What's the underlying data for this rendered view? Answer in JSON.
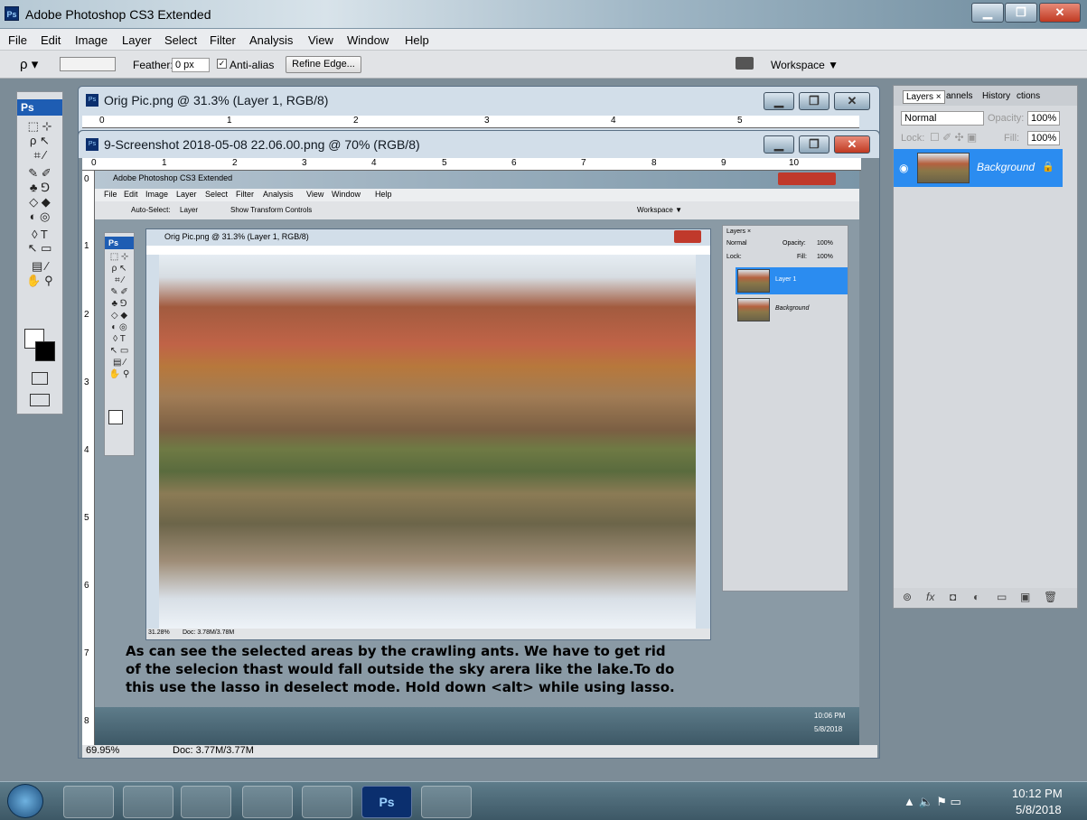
{
  "app": {
    "title": "Adobe Photoshop CS3 Extended",
    "logo": "Ps"
  },
  "menubar": {
    "items": [
      "File",
      "Edit",
      "Image",
      "Layer",
      "Select",
      "Filter",
      "Analysis",
      "View",
      "Window",
      "Help"
    ]
  },
  "options": {
    "feather_label": "Feather:",
    "feather_value": "0 px",
    "antialias_label": "Anti-alias",
    "refine_label": "Refine Edge...",
    "workspace_label": "Workspace ▼"
  },
  "windows": {
    "orig_title": "Orig Pic.png @ 31.3% (Layer 1, RGB/8)",
    "screenshot_title": "9-Screenshot 2018-05-08 22.06.00.png @ 70% (RGB/8)",
    "status_zoom": "69.95%",
    "status_doc": "Doc: 3.77M/3.77M"
  },
  "ruler": {
    "top_ticks": [
      "0",
      "1",
      "2",
      "3",
      "4",
      "5",
      "6",
      "7",
      "8",
      "9",
      "10"
    ],
    "left_ticks": [
      "0",
      "1",
      "2",
      "3",
      "4",
      "5",
      "6",
      "7",
      "8"
    ],
    "orig_ticks": [
      "0",
      "1",
      "2",
      "3",
      "4",
      "5"
    ]
  },
  "inner_ps": {
    "title": "Adobe Photoshop CS3 Extended",
    "menu": [
      "File",
      "Edit",
      "Image",
      "Layer",
      "Select",
      "Filter",
      "Analysis",
      "View",
      "Window",
      "Help"
    ],
    "auto_select": "Auto-Select:",
    "layer_sel": "Layer",
    "show_transform": "Show Transform Controls",
    "workspace": "Workspace ▼",
    "orig_title": "Orig Pic.png @ 31.3% (Layer 1, RGB/8)",
    "status_zoom": "31.28%",
    "status_doc": "Doc: 3.78M/3.78M",
    "layers_tab": "Layers ×",
    "blend": "Normal",
    "opacity_label": "Opacity:",
    "opacity": "100%",
    "lock_label": "Lock:",
    "fill_label": "Fill:",
    "fill": "100%",
    "layer1": "Layer 1",
    "background": "Background",
    "clock_time": "10:06 PM",
    "clock_date": "5/8/2018"
  },
  "layers_panel": {
    "tabs": [
      "Layers ×",
      "annels",
      "History",
      "ctions"
    ],
    "blend_mode": "Normal",
    "opacity_label": "Opacity:",
    "opacity_value": "100%",
    "lock_label": "Lock:",
    "fill_label": "Fill:",
    "fill_value": "100%",
    "layer_name": "Background"
  },
  "caption": {
    "line1": "As can see the selected areas by the crawling ants. We have to get rid",
    "line2": "of the selecion thast would fall outside the sky arera like the lake.To do",
    "line3": "this use the lasso in deselect mode.  Hold down <alt> while using lasso."
  },
  "taskbar": {
    "ps_label": "Ps",
    "time": "10:12 PM",
    "date": "5/8/2018"
  },
  "colors": {
    "accent": "#1e5db3",
    "selected_layer": "#2b8cf0"
  }
}
